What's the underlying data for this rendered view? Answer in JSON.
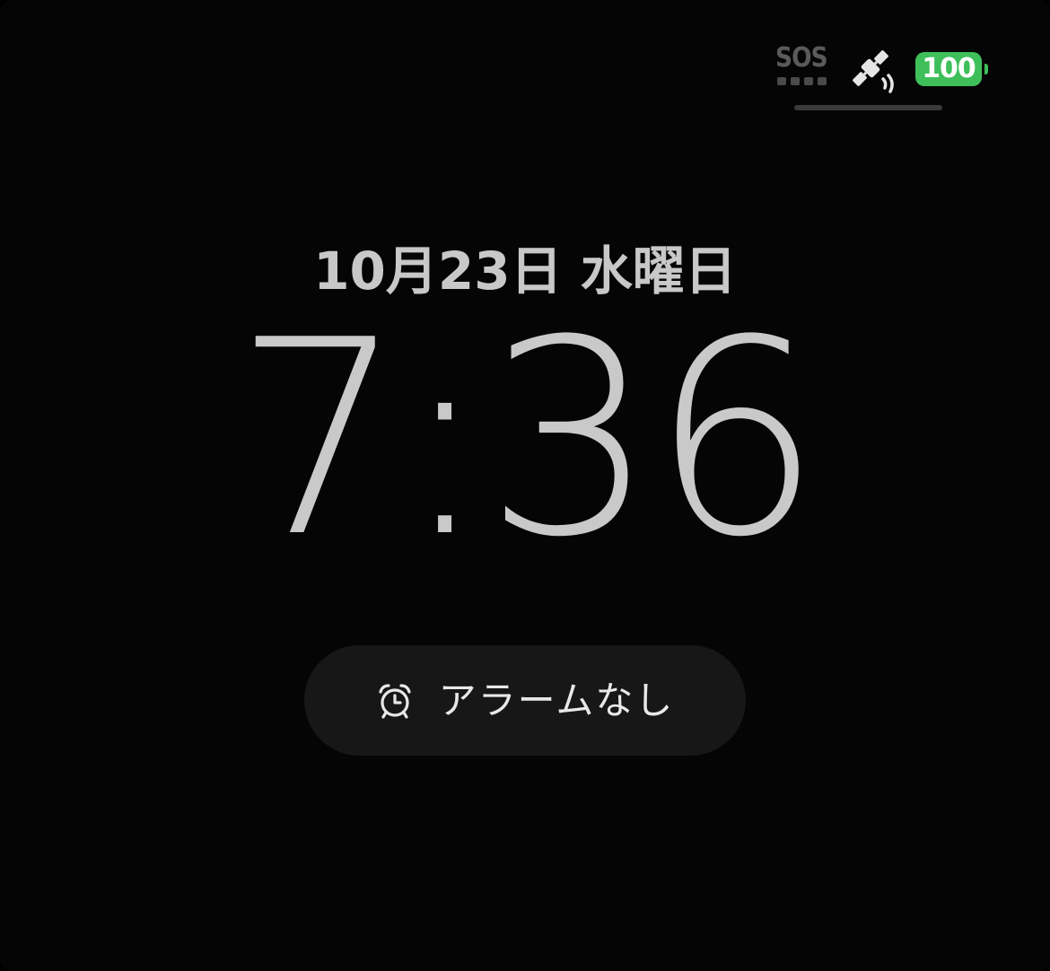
{
  "status_bar": {
    "carrier_text": "SOS",
    "signal_bars": 4,
    "battery_level": "100",
    "battery_color": "#3fbf5a",
    "satellite_icon": "satellite-icon"
  },
  "lock_screen": {
    "date": "10月23日 水曜日",
    "time": "7:36"
  },
  "alarm": {
    "icon": "alarm-clock-icon",
    "label": "アラームなし"
  }
}
